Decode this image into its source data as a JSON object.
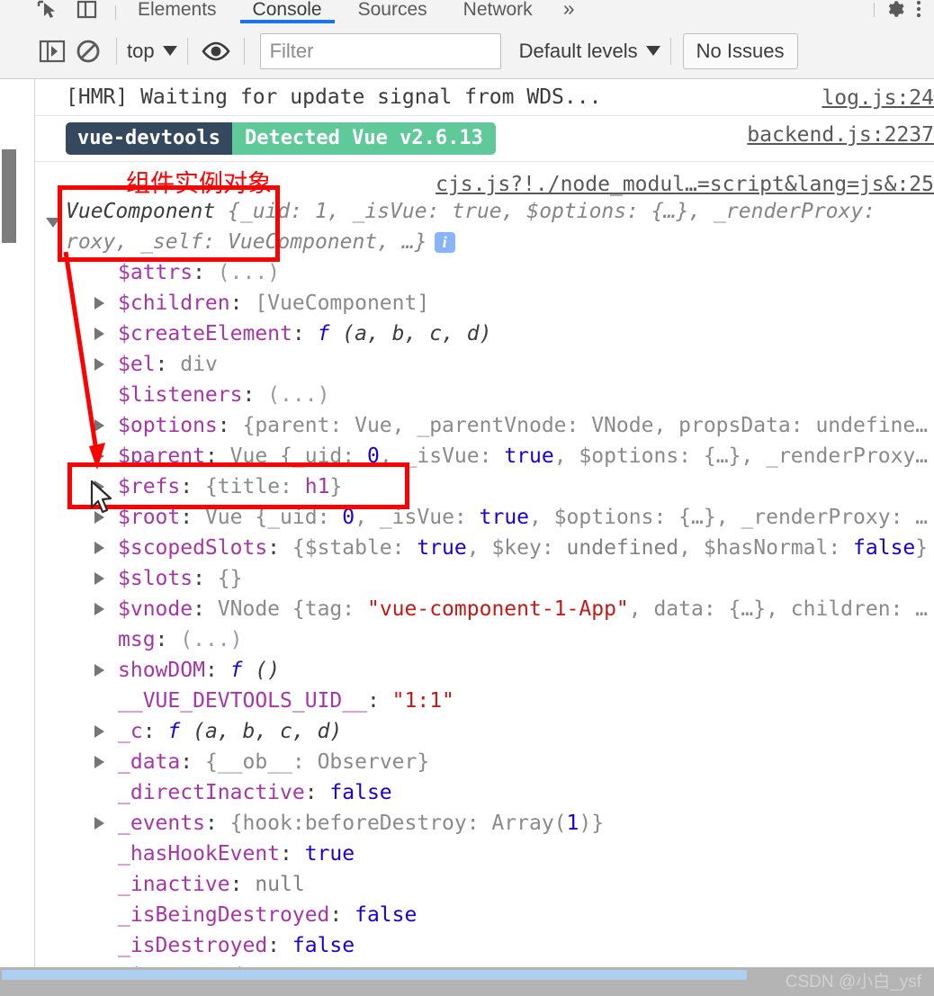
{
  "window": {
    "app": "Chrome DevTools",
    "watermark": "CSDN @小白_ysf"
  },
  "tabstrip": {
    "icons": [
      {
        "name": "inspect-element-icon",
        "label": "Inspect element"
      },
      {
        "name": "device-toolbar-icon",
        "label": "Toggle device toolbar"
      }
    ],
    "tabs": [
      {
        "label": "Elements",
        "active": false
      },
      {
        "label": "Console",
        "active": true
      },
      {
        "label": "Sources",
        "active": false
      },
      {
        "label": "Network",
        "active": false
      }
    ],
    "overflow_label": "»",
    "right_icons": [
      {
        "name": "settings-gear-icon",
        "label": "Settings"
      },
      {
        "name": "more-options-icon",
        "label": "Customize and control DevTools"
      }
    ]
  },
  "toolbar": {
    "sidebar_toggle": "show-console-sidebar-icon",
    "clear_console": "clear-console-icon",
    "context_value": "top",
    "eye_icon": "create-live-expression-icon",
    "filter_placeholder": "Filter",
    "filter_value": "",
    "levels_value": "Default levels",
    "issues_label": "No Issues"
  },
  "messages": [
    {
      "id": "hmr",
      "text": "[HMR] Waiting for update signal from WDS...",
      "source": "log.js:24"
    },
    {
      "id": "vue-devtools",
      "badge_left": "vue-devtools",
      "badge_right": "Detected Vue v2.6.13",
      "source": "backend.js:2237"
    },
    {
      "id": "component-object",
      "source": "cjs.js?!./node_modul…=script&lang=js&:25"
    }
  ],
  "object": {
    "header": {
      "constructor": "VueComponent",
      "preview_line1": " {_uid: 1, _isVue: true, $options: {…}, _renderProxy:",
      "preview_line2": "roxy, _self: VueComponent, …}",
      "info_glyph": "i"
    },
    "properties": [
      {
        "expandable": false,
        "name": "$attrs",
        "value": "(...)",
        "kind": "dim"
      },
      {
        "expandable": true,
        "name": "$children",
        "value": "[VueComponent]",
        "kind": "plain"
      },
      {
        "expandable": true,
        "name": "$createElement",
        "value": "f (a, b, c, d)",
        "kind": "fn"
      },
      {
        "expandable": true,
        "name": "$el",
        "value": "div",
        "kind": "plain"
      },
      {
        "expandable": false,
        "name": "$listeners",
        "value": "(...)",
        "kind": "dim"
      },
      {
        "expandable": true,
        "name": "$options",
        "value": "{parent: Vue, _parentVnode: VNode, propsData: undefine…",
        "kind": "preview"
      },
      {
        "expandable": true,
        "name": "$parent",
        "value": "Vue {_uid: 0, _isVue: true, $options: {…}, _renderProxy…",
        "kind": "preview"
      },
      {
        "expandable": true,
        "name": "$refs",
        "value": "{title: h1}",
        "kind": "refs"
      },
      {
        "expandable": true,
        "name": "$root",
        "value": "Vue {_uid: 0, _isVue: true, $options: {…}, _renderProxy: …",
        "kind": "preview"
      },
      {
        "expandable": true,
        "name": "$scopedSlots",
        "value": "{$stable: true, $key: undefined, $hasNormal: false}",
        "kind": "preview"
      },
      {
        "expandable": true,
        "name": "$slots",
        "value": "{}",
        "kind": "plain"
      },
      {
        "expandable": true,
        "name": "$vnode",
        "value": "VNode {tag: \"vue-component-1-App\", data: {…}, children: …",
        "kind": "vnode"
      },
      {
        "expandable": false,
        "name": "msg",
        "value": "(...)",
        "kind": "dim"
      },
      {
        "expandable": true,
        "name": "showDOM",
        "value": "f ()",
        "kind": "fn"
      },
      {
        "expandable": false,
        "name": "__VUE_DEVTOOLS_UID__",
        "value": "\"1:1\"",
        "kind": "str"
      },
      {
        "expandable": true,
        "name": "_c",
        "value": "f (a, b, c, d)",
        "kind": "fn"
      },
      {
        "expandable": true,
        "name": "_data",
        "value": "{__ob__: Observer}",
        "kind": "preview"
      },
      {
        "expandable": false,
        "name": "_directInactive",
        "value": "false",
        "kind": "bool"
      },
      {
        "expandable": true,
        "name": "_events",
        "value": "{hook:beforeDestroy: Array(1)}",
        "kind": "preview"
      },
      {
        "expandable": false,
        "name": "_hasHookEvent",
        "value": "true",
        "kind": "bool"
      },
      {
        "expandable": false,
        "name": "_inactive",
        "value": "null",
        "kind": "null"
      },
      {
        "expandable": false,
        "name": "_isBeingDestroyed",
        "value": "false",
        "kind": "bool"
      },
      {
        "expandable": false,
        "name": "_isDestroyed",
        "value": "false",
        "kind": "bool"
      },
      {
        "expandable": false,
        "name": "_isMounted",
        "value": "true",
        "kind": "bool"
      }
    ]
  },
  "annotations": {
    "label": "组件实例对象",
    "color": "#ff0000",
    "boxes": [
      {
        "name": "component-object-highlight"
      },
      {
        "name": "refs-highlight"
      }
    ]
  }
}
